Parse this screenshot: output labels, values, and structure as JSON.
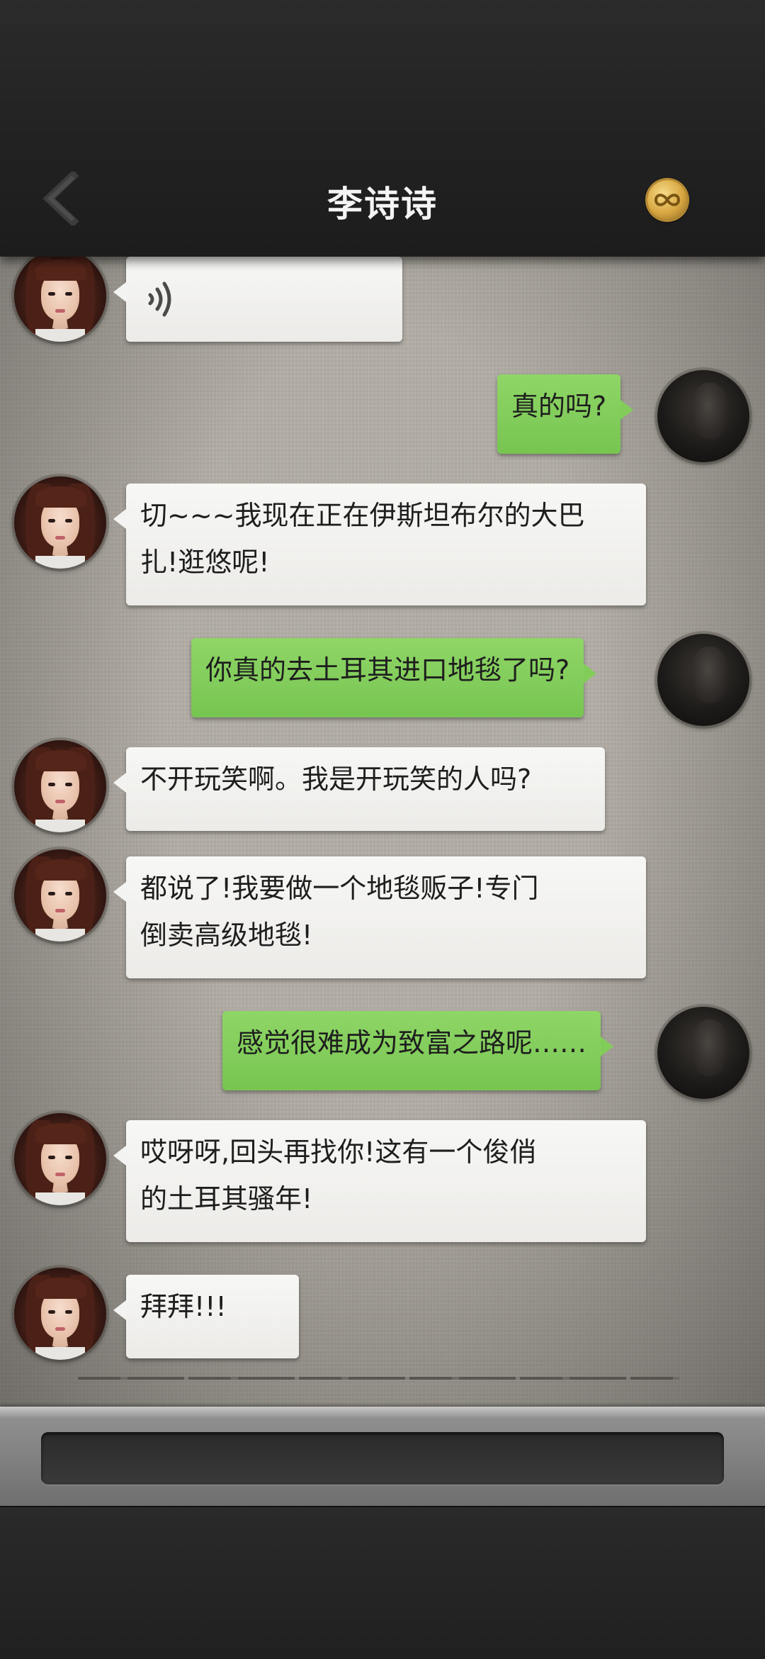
{
  "header": {
    "title": "李诗诗",
    "back_icon": "chevron-left-icon",
    "coin_icon": "gold-coin-infinity-icon"
  },
  "messages": [
    {
      "from": "her",
      "type": "voice",
      "text": ""
    },
    {
      "from": "me",
      "type": "text",
      "text": "真的吗?"
    },
    {
      "from": "her",
      "type": "text",
      "line1": "切~~~我现在正在伊斯坦布尔的大巴",
      "line2": "扎!逛悠呢!"
    },
    {
      "from": "me",
      "type": "text",
      "text": "你真的去土耳其进口地毯了吗?"
    },
    {
      "from": "her",
      "type": "text",
      "text": "不开玩笑啊。我是开玩笑的人吗?"
    },
    {
      "from": "her",
      "type": "text",
      "line1": "都说了!我要做一个地毯贩子!专门",
      "line2": "倒卖高级地毯!"
    },
    {
      "from": "me",
      "type": "text",
      "text": "感觉很难成为致富之路呢……"
    },
    {
      "from": "her",
      "type": "text",
      "line1": "哎呀呀,回头再找你!这有一个俊俏",
      "line2": "的土耳其骚年!"
    },
    {
      "from": "her",
      "type": "text",
      "text": "拜拜!!!"
    }
  ],
  "input": {
    "value": "",
    "placeholder": ""
  },
  "colors": {
    "incoming_bubble": "#f3f3f1",
    "outgoing_bubble": "#82cd5a",
    "coin": "#d7a640"
  }
}
